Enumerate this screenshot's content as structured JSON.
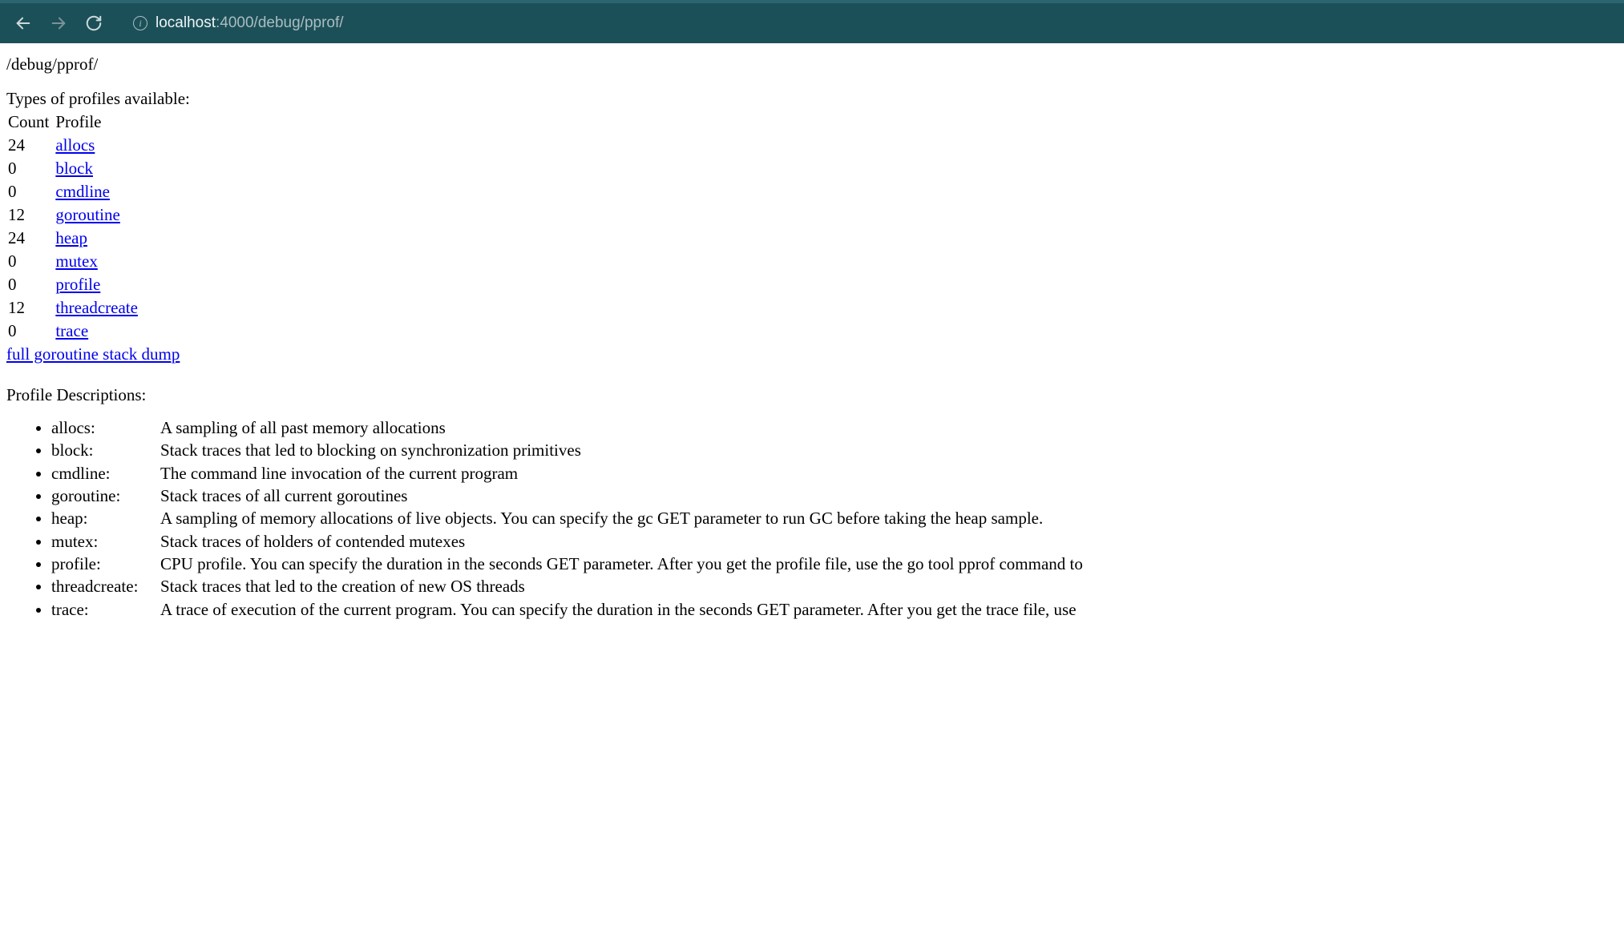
{
  "browser": {
    "url_host": "localhost",
    "url_port_path": ":4000/debug/pprof/"
  },
  "page": {
    "path_heading": "/debug/pprof/",
    "profiles_title": "Types of profiles available:",
    "table_header_count": "Count",
    "table_header_profile": "Profile",
    "profiles": [
      {
        "count": "24",
        "name": "allocs"
      },
      {
        "count": "0",
        "name": "block"
      },
      {
        "count": "0",
        "name": "cmdline"
      },
      {
        "count": "12",
        "name": "goroutine"
      },
      {
        "count": "24",
        "name": "heap"
      },
      {
        "count": "0",
        "name": "mutex"
      },
      {
        "count": "0",
        "name": "profile"
      },
      {
        "count": "12",
        "name": "threadcreate"
      },
      {
        "count": "0",
        "name": "trace"
      }
    ],
    "full_dump_label": "full goroutine stack dump",
    "descriptions_title": "Profile Descriptions:",
    "descriptions": [
      {
        "name": "allocs:",
        "text": "A sampling of all past memory allocations"
      },
      {
        "name": "block:",
        "text": "Stack traces that led to blocking on synchronization primitives"
      },
      {
        "name": "cmdline:",
        "text": "The command line invocation of the current program"
      },
      {
        "name": "goroutine:",
        "text": "Stack traces of all current goroutines"
      },
      {
        "name": "heap:",
        "text": "A sampling of memory allocations of live objects. You can specify the gc GET parameter to run GC before taking the heap sample."
      },
      {
        "name": "mutex:",
        "text": "Stack traces of holders of contended mutexes"
      },
      {
        "name": "profile:",
        "text": "CPU profile. You can specify the duration in the seconds GET parameter. After you get the profile file, use the go tool pprof command to"
      },
      {
        "name": "threadcreate:",
        "text": "Stack traces that led to the creation of new OS threads"
      },
      {
        "name": "trace:",
        "text": "A trace of execution of the current program. You can specify the duration in the seconds GET parameter. After you get the trace file, use"
      }
    ]
  }
}
